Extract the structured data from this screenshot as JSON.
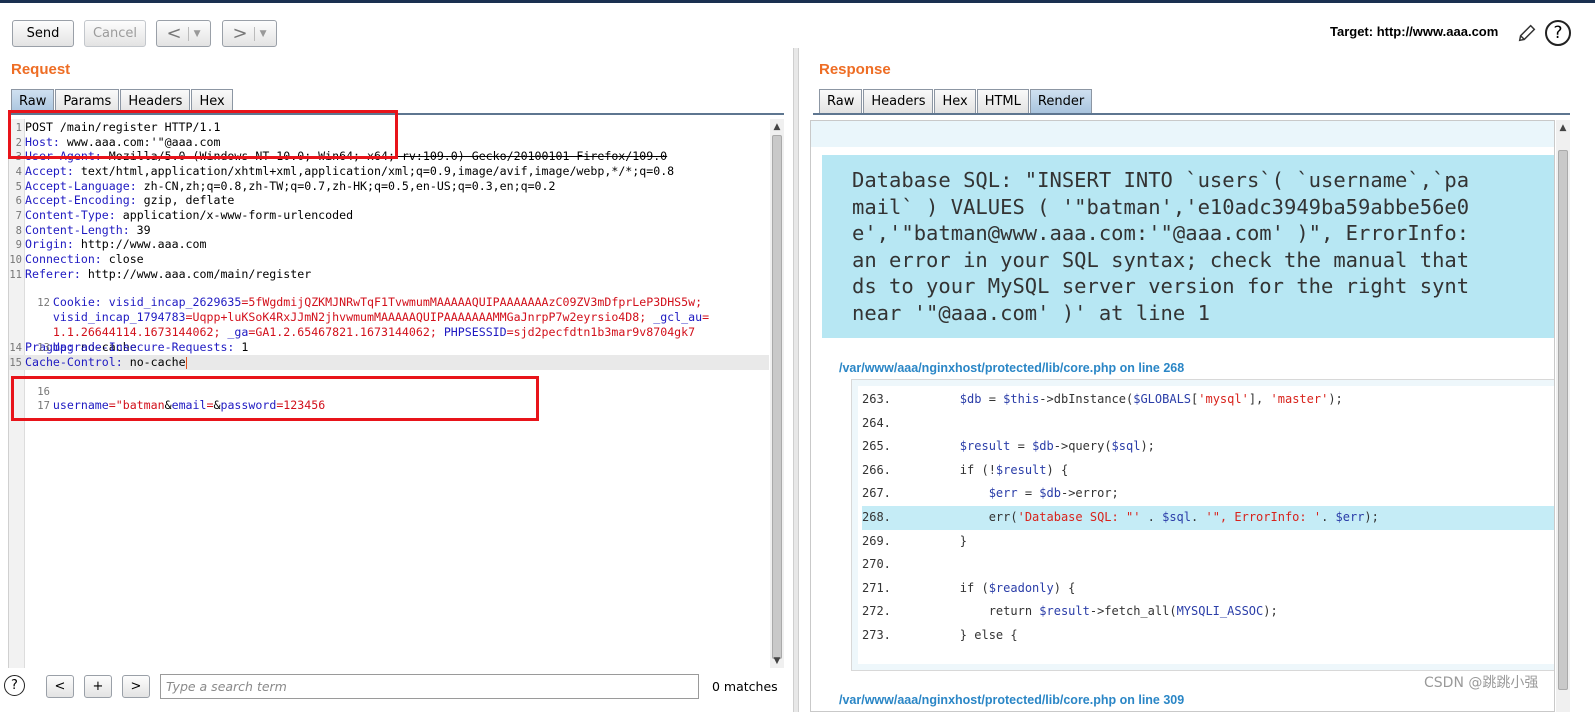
{
  "toolbar": {
    "send_label": "Send",
    "cancel_label": "Cancel",
    "back_arrow": "<",
    "forward_arrow": ">",
    "dropdown_glyph": "▼",
    "target_label": "Target: http://www.aaa.com",
    "help_glyph": "?"
  },
  "request": {
    "title": "Request",
    "tabs": [
      "Raw",
      "Params",
      "Headers",
      "Hex"
    ],
    "active_tab": "Raw",
    "lines": [
      {
        "n": "1",
        "key": "",
        "val": "POST /main/register HTTP/1.1"
      },
      {
        "n": "2",
        "key": "Host:",
        "val": " www.aaa.com:'\"@aaa.com"
      },
      {
        "n": "3",
        "key": "User-Agent:",
        "val": " Mozilla/5.0 (Windows NT 10.0; Win64; x64; rv:109.0) Gecko/20100101 Firefox/109.0"
      },
      {
        "n": "4",
        "key": "Accept:",
        "val": " text/html,application/xhtml+xml,application/xml;q=0.9,image/avif,image/webp,*/*;q=0.8"
      },
      {
        "n": "5",
        "key": "Accept-Language:",
        "val": " zh-CN,zh;q=0.8,zh-TW;q=0.7,zh-HK;q=0.5,en-US;q=0.3,en;q=0.2"
      },
      {
        "n": "6",
        "key": "Accept-Encoding:",
        "val": " gzip, deflate"
      },
      {
        "n": "7",
        "key": "Content-Type:",
        "val": " application/x-www-form-urlencoded"
      },
      {
        "n": "8",
        "key": "Content-Length:",
        "val": " 39"
      },
      {
        "n": "9",
        "key": "Origin:",
        "val": " http://www.aaa.com"
      },
      {
        "n": "10",
        "key": "Connection:",
        "val": " close"
      },
      {
        "n": "11",
        "key": "Referer:",
        "val": " http://www.aaa.com/main/register"
      },
      {
        "n": "14",
        "key": "Pragma:",
        "val": " no-cache"
      },
      {
        "n": "15",
        "key": "Cache-Control:",
        "val": " no-cache"
      }
    ],
    "cookie": {
      "n": "12",
      "key": "Cookie:",
      "c1k": " visid_incap_2629635",
      "c1v": "=5fWgdmijQZKMJNRwTqF1TvwmumMAAAAAQUIPAAAAAAAzC09ZV3mDfprLeP3DHS5w;",
      "c2k": "visid_incap_1794783",
      "c2v": "=Uqpp+luKSoK4RxJJmN2jhvwmumMAAAAAQUIPAAAAAAAMMGaJnrpP7w2eyrsio4D8;",
      "c3k": " _gcl_au",
      "c3v": "=",
      "c4v": "1.1.26644114.1673144062;",
      "c5k": " _ga",
      "c5v": "=GA1.2.65467821.1673144062;",
      "c6k": " PHPSESSID",
      "c6v": "=sjd2pecfdtn1b3mar9v8704gk7"
    },
    "line13": {
      "n": "13",
      "key": "Upgrade-Insecure-Requests:",
      "val": " 1"
    },
    "line16": {
      "n": "16"
    },
    "body": {
      "n": "17",
      "k1": "username",
      "v1": "=\"batman",
      "amp1": "&",
      "k2": "email",
      "v2": "=",
      "amp2": "&",
      "k3": "password",
      "v3": "=123456"
    }
  },
  "search": {
    "help_glyph": "?",
    "prev_label": "<",
    "add_label": "+",
    "next_label": ">",
    "placeholder": "Type a search term",
    "matches": "0 matches"
  },
  "response": {
    "title": "Response",
    "tabs": [
      "Raw",
      "Headers",
      "Hex",
      "HTML",
      "Render"
    ],
    "active_tab": "Render",
    "error_lines": [
      "Database SQL: \"INSERT INTO `users`( `username`,`pa",
      "mail` ) VALUES ( '\"batman','e10adc3949ba59abbe56e0",
      "e','\"batman@www.aaa.com:'\"@aaa.com' )\", ErrorInfo:",
      "an error in your SQL syntax; check the manual that",
      "ds to your MySQL server version for the right synt",
      "near '\"@aaa.com' )' at line 1"
    ],
    "file_path": "/var/www/aaa/nginxhost/protected/lib/core.php on line 268",
    "file_path_2": "/var/www/aaa/nginxhost/protected/lib/core.php on line 309",
    "source": [
      {
        "num": "263.",
        "code": "        <v>$db</v> = <v>$this</v>->dbInstance(<v>$GLOBALS</v>[<s>'mysql'</s>], <s>'master'</s>);"
      },
      {
        "num": "264.",
        "code": ""
      },
      {
        "num": "265.",
        "code": "        <v>$result</v> = <v>$db</v>->query(<v>$sql</v>);"
      },
      {
        "num": "266.",
        "code": "        if (!<v>$result</v>) {"
      },
      {
        "num": "267.",
        "code": "            <v>$err</v> = <v>$db</v>->error;"
      },
      {
        "num": "268.",
        "code": "            err(<s>'Database SQL: \"'</s> . <v>$sql</v>. <s>'\", ErrorInfo: '</s>. <v>$err</v>);",
        "hl": true
      },
      {
        "num": "269.",
        "code": "        }"
      },
      {
        "num": "270.",
        "code": ""
      },
      {
        "num": "271.",
        "code": "        if (<v>$readonly</v>) {"
      },
      {
        "num": "272.",
        "code": "            return <v>$result</v>->fetch_all(<c>MYSQLI_ASSOC</c>);"
      },
      {
        "num": "273.",
        "code": "        } else {"
      }
    ]
  },
  "watermark": "CSDN @跳跳小强",
  "colors": {
    "accent_orange": "#ee6d24",
    "highlight_red": "#e8141a",
    "error_bg": "#b7e7f3",
    "link_blue": "#2a86c6"
  }
}
